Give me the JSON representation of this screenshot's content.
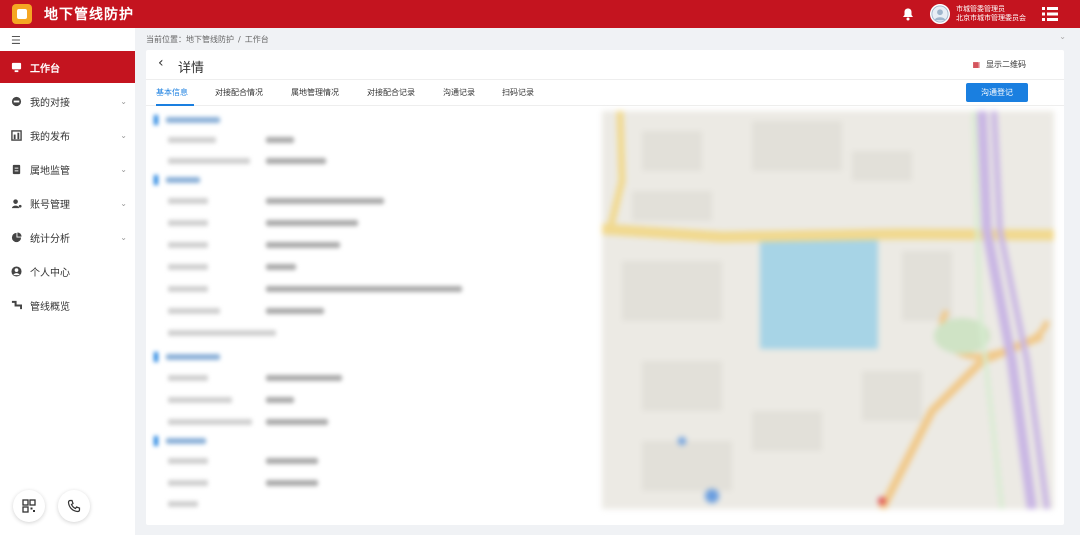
{
  "app": {
    "title": "地下管线防护",
    "user_role": "市城管委管理员",
    "user_org": "北京市城市管理委员会"
  },
  "colors": {
    "brand": "#c4141f",
    "accent": "#1a7fe0",
    "logo": "#f5a623",
    "map_water": "#a7d4e6",
    "map_road": "#f1d98f"
  },
  "icons": {
    "logo": "app-logo-icon",
    "bell": "bell-icon",
    "avatar": "user-avatar-icon",
    "menu": "menu-list-icon",
    "collapse": "hamburger-icon",
    "qrcode": "qrcode-icon",
    "phone": "phone-icon"
  },
  "sidebar": {
    "items": [
      {
        "label": "工作台",
        "icon": "workbench-icon",
        "active": true,
        "has_chevron": false
      },
      {
        "label": "我的对接",
        "icon": "handshake-icon",
        "active": false,
        "has_chevron": true
      },
      {
        "label": "我的发布",
        "icon": "publish-icon",
        "active": false,
        "has_chevron": true
      },
      {
        "label": "属地监管",
        "icon": "clipboard-icon",
        "active": false,
        "has_chevron": true
      },
      {
        "label": "账号管理",
        "icon": "account-icon",
        "active": false,
        "has_chevron": true
      },
      {
        "label": "统计分析",
        "icon": "pie-chart-icon",
        "active": false,
        "has_chevron": true
      },
      {
        "label": "个人中心",
        "icon": "person-icon",
        "active": false,
        "has_chevron": false
      },
      {
        "label": "管线概览",
        "icon": "pipeline-icon",
        "active": false,
        "has_chevron": false
      }
    ]
  },
  "breadcrumb": {
    "prefix": "当前位置：",
    "items": [
      "地下管线防护",
      "工作台"
    ],
    "separator": "/"
  },
  "detail": {
    "title": "详情",
    "qr_label": "显示二维码",
    "action_button": "沟通登记"
  },
  "tabs": [
    {
      "label": "基本信息",
      "active": true
    },
    {
      "label": "对接配合情况",
      "active": false
    },
    {
      "label": "属地管理情况",
      "active": false
    },
    {
      "label": "对接配合记录",
      "active": false
    },
    {
      "label": "沟通记录",
      "active": false
    },
    {
      "label": "扫码记录",
      "active": false
    }
  ]
}
